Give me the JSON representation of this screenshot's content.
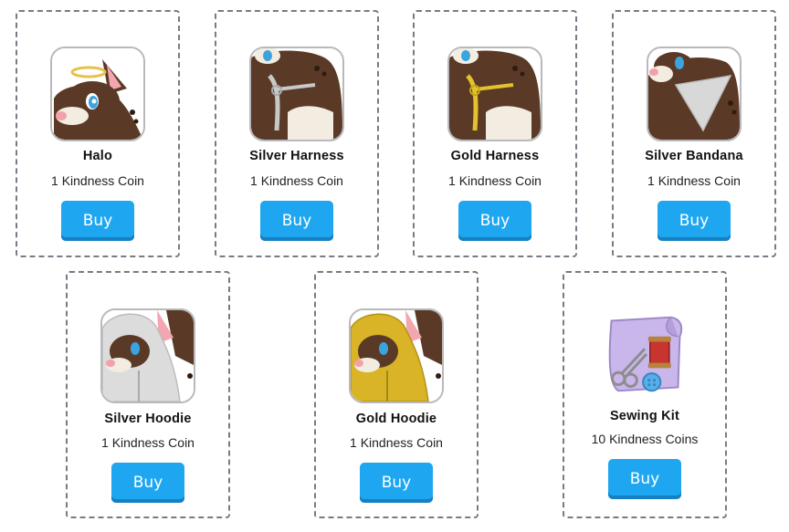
{
  "shop": {
    "items": [
      {
        "name": "Halo",
        "price": "1 Kindness Coin",
        "buy_label": "Buy",
        "accent": "#e8c04a"
      },
      {
        "name": "Silver Harness",
        "price": "1 Kindness Coin",
        "buy_label": "Buy",
        "accent": "#c8c8c8"
      },
      {
        "name": "Gold Harness",
        "price": "1 Kindness Coin",
        "buy_label": "Buy",
        "accent": "#e3c22c"
      },
      {
        "name": "Silver Bandana",
        "price": "1 Kindness Coin",
        "buy_label": "Buy",
        "accent": "#d8d8d8"
      },
      {
        "name": "Silver Hoodie",
        "price": "1 Kindness Coin",
        "buy_label": "Buy",
        "accent": "#dcdcdc"
      },
      {
        "name": "Gold Hoodie",
        "price": "1 Kindness Coin",
        "buy_label": "Buy",
        "accent": "#d8b426"
      },
      {
        "name": "Sewing Kit",
        "price": "10 Kindness Coins",
        "buy_label": "Buy",
        "accent": "#c9b6ea"
      }
    ]
  },
  "colors": {
    "buy_button": "#1ea7f0",
    "card_border": "#7a7a85",
    "creature_fur": "#5a3a26",
    "creature_cream": "#f3ece0"
  }
}
